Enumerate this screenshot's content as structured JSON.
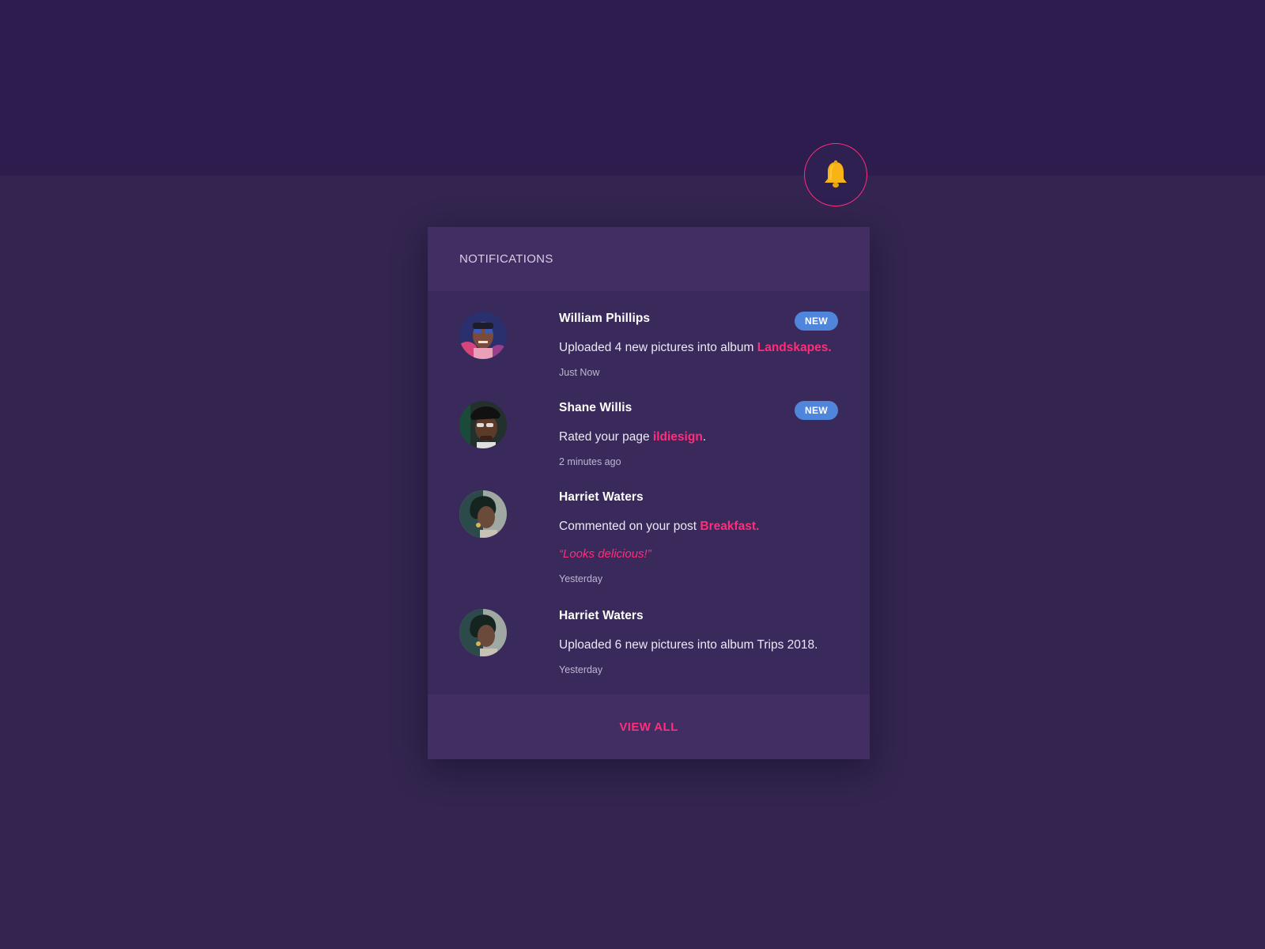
{
  "bell": {
    "icon": "bell-icon",
    "accent": "#ff2d7a",
    "icon_color": "#f8b416"
  },
  "panel": {
    "title": "NOTIFICATIONS",
    "view_all_label": "VIEW ALL",
    "notifications": [
      {
        "name": "William Phillips",
        "badge": "NEW",
        "text_before": "Uploaded 4 new pictures into album ",
        "link": "Landskapes.",
        "text_after": "",
        "time": "Just Now"
      },
      {
        "name": "Shane Willis",
        "badge": "NEW",
        "text_before": "Rated your page ",
        "link": "ildiesign",
        "text_after": ".",
        "time": "2 minutes ago"
      },
      {
        "name": "Harriet Waters",
        "text_before": "Commented on your post ",
        "link": "Breakfast.",
        "text_after": "",
        "quote": "“Looks delicious!”",
        "time": "Yesterday"
      },
      {
        "name": "Harriet Waters",
        "text_before": "Uploaded 6 new pictures into album Trips 2018.",
        "time": "Yesterday"
      }
    ]
  },
  "colors": {
    "background": "#33254f",
    "top_band": "#2c1d4e",
    "panel": "#3a2a5c",
    "panel_header": "#422e63",
    "link": "#ff2d7a",
    "badge": "#4f86dc"
  }
}
